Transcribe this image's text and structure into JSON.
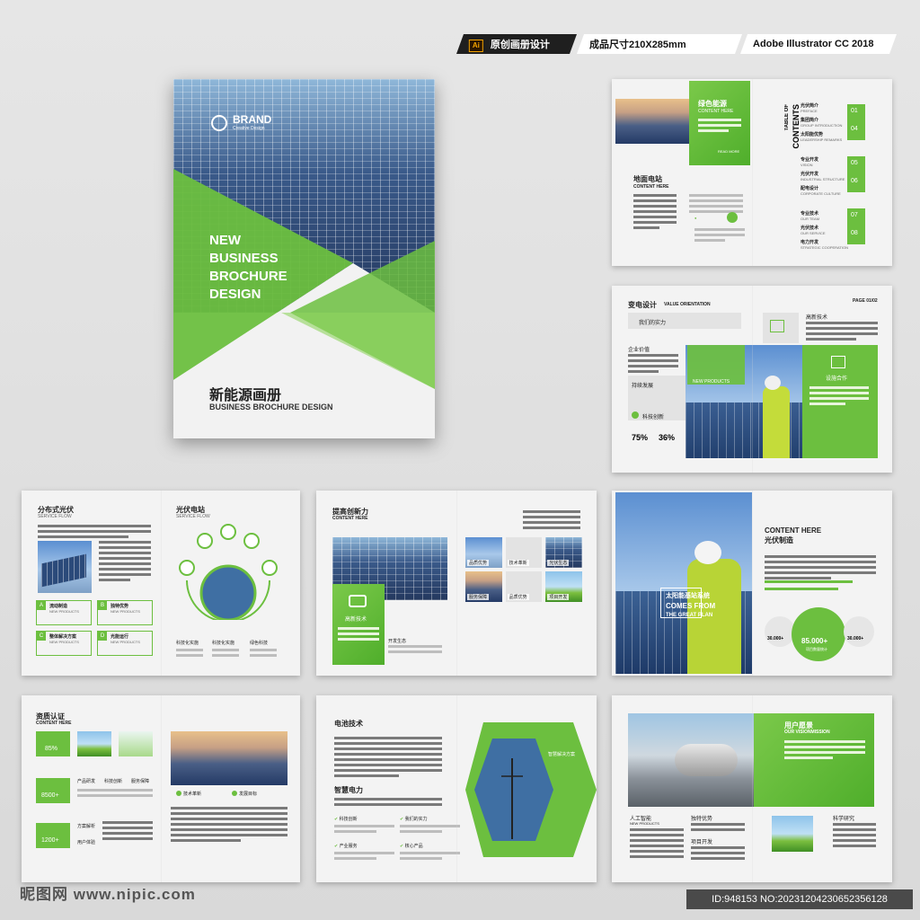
{
  "tags": {
    "software_badge": "Ai",
    "tag1": "原创画册设计",
    "tag2": "成品尺寸210X285mm",
    "tag3": "Adobe Illustrator CC 2018"
  },
  "cover": {
    "brand": "BRAND",
    "brand_sub": "Creative Design",
    "headline": [
      "NEW",
      "BUSINESS",
      "BROCHURE",
      "DESIGN"
    ],
    "cn_title": "新能源画册",
    "en_title": "BUSINESS BROCHURE DESIGN"
  },
  "spread1": {
    "green_title": "绿色能源",
    "green_sub": "CONTENT HERE",
    "read_more": "READ MORE",
    "left_title": "地面电站",
    "left_sub": "CONTENT HERE",
    "toc": "TABLE OF",
    "contents": "CONTENTS",
    "toc_items": [
      {
        "cn": "光伏简介",
        "en": "PREFACE"
      },
      {
        "cn": "集团简介",
        "en": "GROUP INTRODUCTION"
      },
      {
        "cn": "太阳能优势",
        "en": "LEADERSHIP REMARKS"
      },
      {
        "cn": "专业开发",
        "en": "VISION"
      },
      {
        "cn": "光伏开发",
        "en": "INDUSTRIAL STRUCTURE"
      },
      {
        "cn": "配电设计",
        "en": "CORPORATE CULTURE"
      },
      {
        "cn": "专业技术",
        "en": "OUR TEAM"
      },
      {
        "cn": "光伏技术",
        "en": "OUR SERVICE"
      },
      {
        "cn": "电力开发",
        "en": "STRATEGIC COOPERATION"
      }
    ],
    "toc_numbers": [
      "01",
      "04",
      "05",
      "06",
      "07",
      "08"
    ]
  },
  "spread2": {
    "title": "变电设计",
    "title_en": "VALUE ORIENTATION",
    "page": "PAGE 01/02",
    "item1": "我们的实力",
    "item2": "企业价值",
    "item3": "持续发展",
    "item4": "科技创新",
    "stat1": "75%",
    "stat2": "36%",
    "right1": "高新技术",
    "green_box": "设施合作",
    "new_products": "NEW PRODUCTS"
  },
  "spread3": {
    "left_title": "分布式光伏",
    "left_sub": "SERVICE FLOW",
    "right_title": "光伏电站",
    "right_sub": "SERVICE FLOW",
    "grid": [
      {
        "k": "A",
        "label": "流动制造",
        "en": "NEW PRODUCTS"
      },
      {
        "k": "B",
        "label": "独特优势",
        "en": "NEW PRODUCTS"
      },
      {
        "k": "C",
        "label": "整体解决方案",
        "en": "NEW PRODUCTS"
      },
      {
        "k": "D",
        "label": "光能运行",
        "en": "NEW PRODUCTS"
      }
    ],
    "bottom": [
      "科技化实施",
      "科技化实施",
      "绿色科技"
    ]
  },
  "spread4": {
    "title": "提高创新力",
    "sub": "CONTENT HERE",
    "green_label": "高新技术",
    "mid_label": "开发生态",
    "tiles": [
      "品质优势",
      "技术革新",
      "光伏生态",
      "服务保障",
      "品质优势",
      "项目开发"
    ]
  },
  "spread5": {
    "overlay1": "太阳能基站系统",
    "overlay2": "COMES FROM",
    "overlay3": "THE GREAT PLAN",
    "title_en": "CONTENT HERE",
    "title_cn": "光伏制造",
    "stat_left": "30.000+",
    "stat_mid": "85.000+",
    "stat_mid_sub": "项目数量统计",
    "stat_right": "30.000+"
  },
  "spread6": {
    "title": "资质认证",
    "sub": "CONTENT HERE",
    "stats": [
      "85%",
      "8500+",
      "1200+"
    ],
    "icons": [
      "产品研发",
      "科技创新",
      "服务保障"
    ],
    "labels": [
      "方案解析",
      "用户体验"
    ],
    "right_labels": [
      "技术革新",
      "发展目标"
    ]
  },
  "spread7": {
    "title1": "电池技术",
    "title2": "智慧电力",
    "checks": [
      "科技创新",
      "我们的实力",
      "产业服务",
      "核心产品"
    ],
    "green_label": "智慧解决方案"
  },
  "spread8": {
    "green_title": "用户愿景",
    "green_sub": "OUR VISIONMISSION",
    "col1": "人工智能",
    "col1_sub": "NEW PRODUCTS",
    "col2": "独特优势",
    "col3": "项目开发",
    "right": "科学研究"
  },
  "watermark": "昵图网 www.nipic.com",
  "id_text": "ID:948153 NO:20231204230652356128"
}
